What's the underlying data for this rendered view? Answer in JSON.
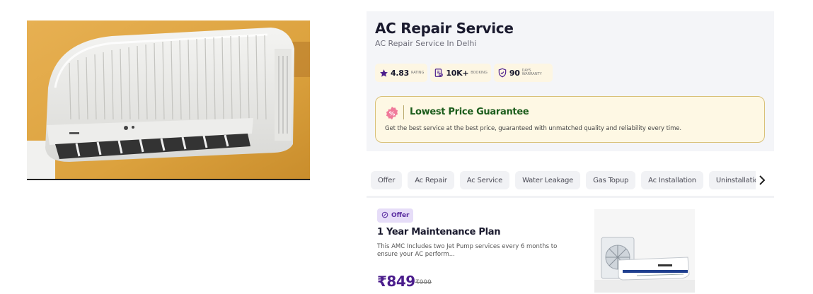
{
  "product": {
    "image_name": "air-conditioner-photo",
    "title": "AC Repair Service",
    "subtitle": "AC Repair Service In Delhi"
  },
  "stats": [
    {
      "icon": "star-icon",
      "value": "4.83",
      "label": "RATING"
    },
    {
      "icon": "booking-icon",
      "value": "10K+",
      "label": "BOOKING"
    },
    {
      "icon": "shield-icon",
      "value": "90",
      "label": "DAYS WARRANTY"
    }
  ],
  "guarantee": {
    "icon": "discount-badge-icon",
    "title": "Lowest Price Guarantee",
    "text": "Get the best service at the best price, guaranteed with unmatched quality and reliability every time."
  },
  "categories": [
    "Offer",
    "Ac Repair",
    "Ac Service",
    "Water Leakage",
    "Gas Topup",
    "Ac Installation",
    "Uninstallation"
  ],
  "plan": {
    "badge": "Offer",
    "title": "1 Year Maintenance Plan",
    "description": "This AMC Includes two Jet Pump services every 6 months to ensure your AC perform...",
    "price": "₹849",
    "old_price": "₹999"
  },
  "colors": {
    "accent": "#4b1d8c",
    "guarantee_title": "#1b5c1b",
    "guarantee_bg": "#fef8e4",
    "card_bg": "#f4f5f8"
  }
}
